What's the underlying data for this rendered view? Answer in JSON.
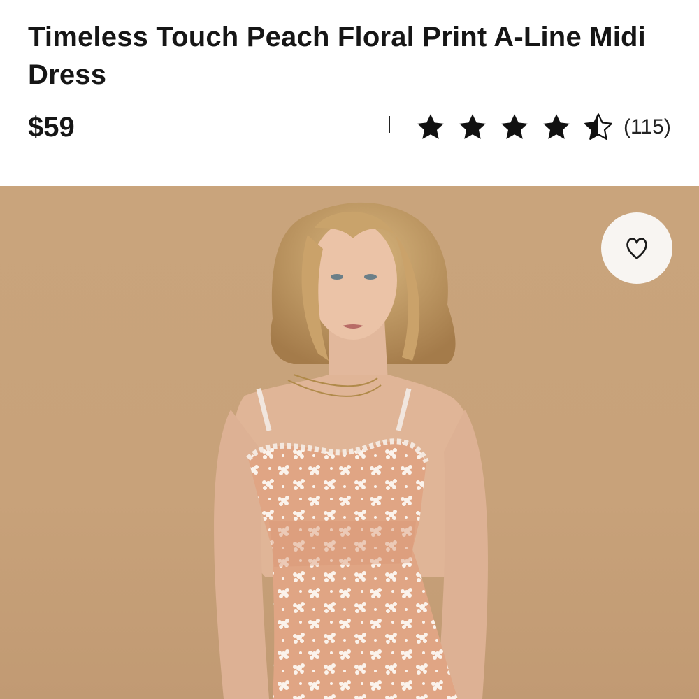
{
  "product": {
    "title": "Timeless Touch Peach Floral Print A-Line Midi Dress",
    "price": "$59"
  },
  "rating": {
    "value": 4.5,
    "max": 5,
    "review_count": "(115)"
  },
  "image": {
    "icon": "wishlist-heart-icon",
    "background_color": "#c9a47c",
    "dress_color": "#e2a88a"
  }
}
